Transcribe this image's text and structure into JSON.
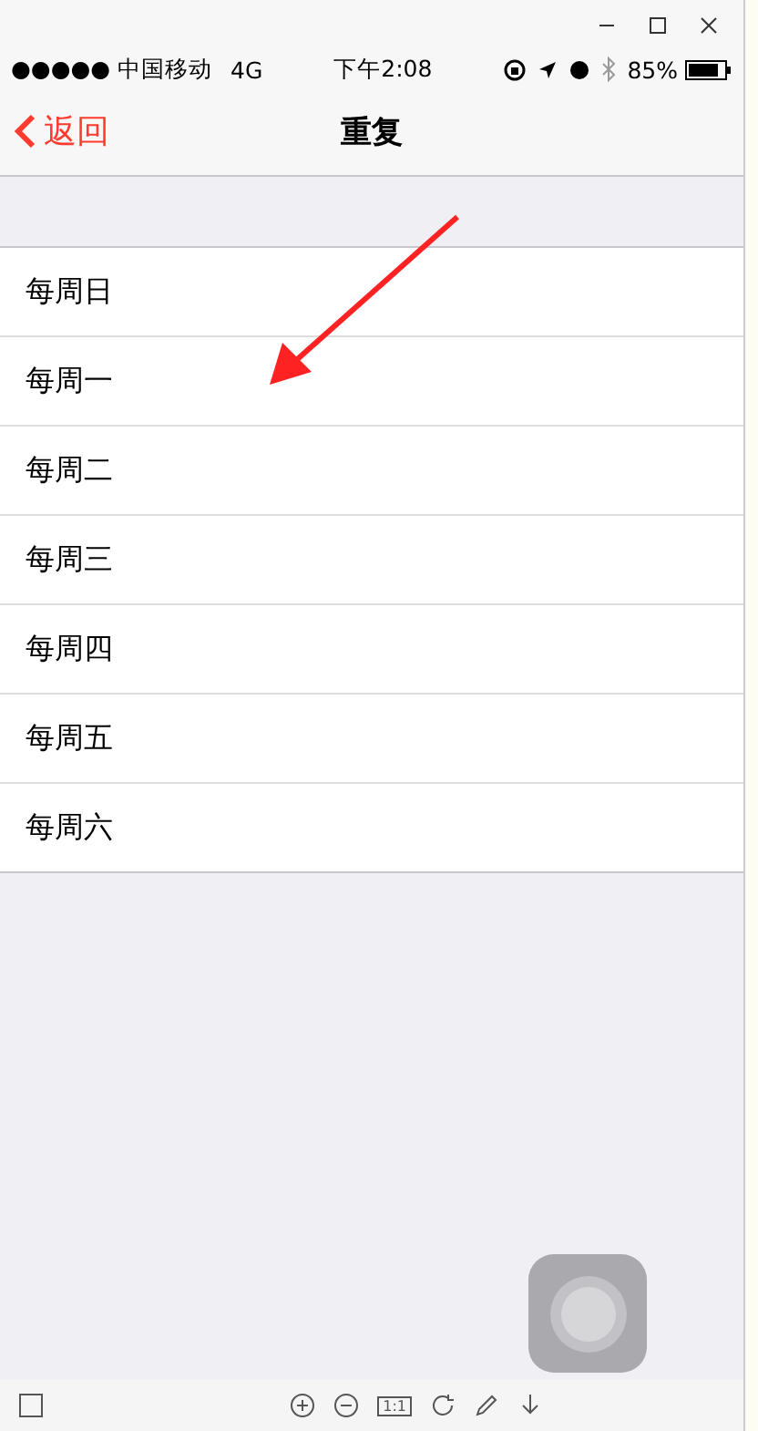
{
  "status_bar": {
    "carrier": "●●●●● 中国移动",
    "network": "4G",
    "time": "下午2:08",
    "battery": "85%"
  },
  "nav": {
    "back": "返回",
    "title": "重复"
  },
  "days": [
    "每周日",
    "每周一",
    "每周二",
    "每周三",
    "每周四",
    "每周五",
    "每周六"
  ],
  "viewer_toolbar": {
    "actual_size": "1:1"
  }
}
